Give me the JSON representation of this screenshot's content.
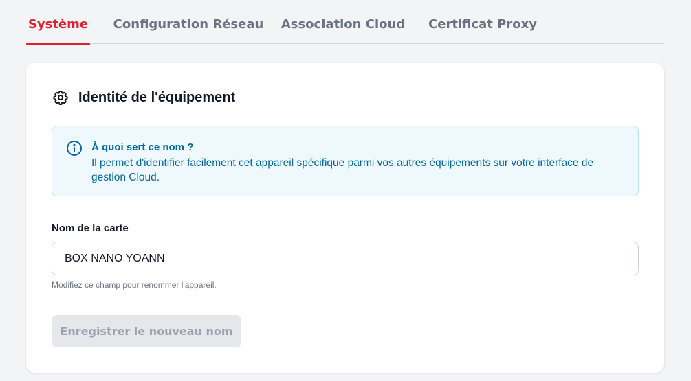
{
  "tabs": [
    {
      "label": "Système",
      "active": true
    },
    {
      "label": "Configuration Réseau",
      "active": false
    },
    {
      "label": "Association Cloud",
      "active": false
    },
    {
      "label": "Certificat Proxy",
      "active": false
    }
  ],
  "card": {
    "icon": "gear-icon",
    "title": "Identité de l'équipement"
  },
  "info": {
    "icon": "info-icon",
    "title": "À quoi sert ce nom ?",
    "text": "Il permet d'identifier facilement cet appareil spécifique parmi vos autres équipements sur votre interface de gestion Cloud."
  },
  "form": {
    "label": "Nom de la carte",
    "value": "BOX NANO YOANN",
    "hint": "Modifiez ce champ pour renommer l'appareil.",
    "save_label": "Enregistrer le nouveau nom",
    "save_disabled": true
  },
  "colors": {
    "accent": "#e11d2e",
    "info": "#0369a1",
    "info_bg": "#eff8fd"
  }
}
